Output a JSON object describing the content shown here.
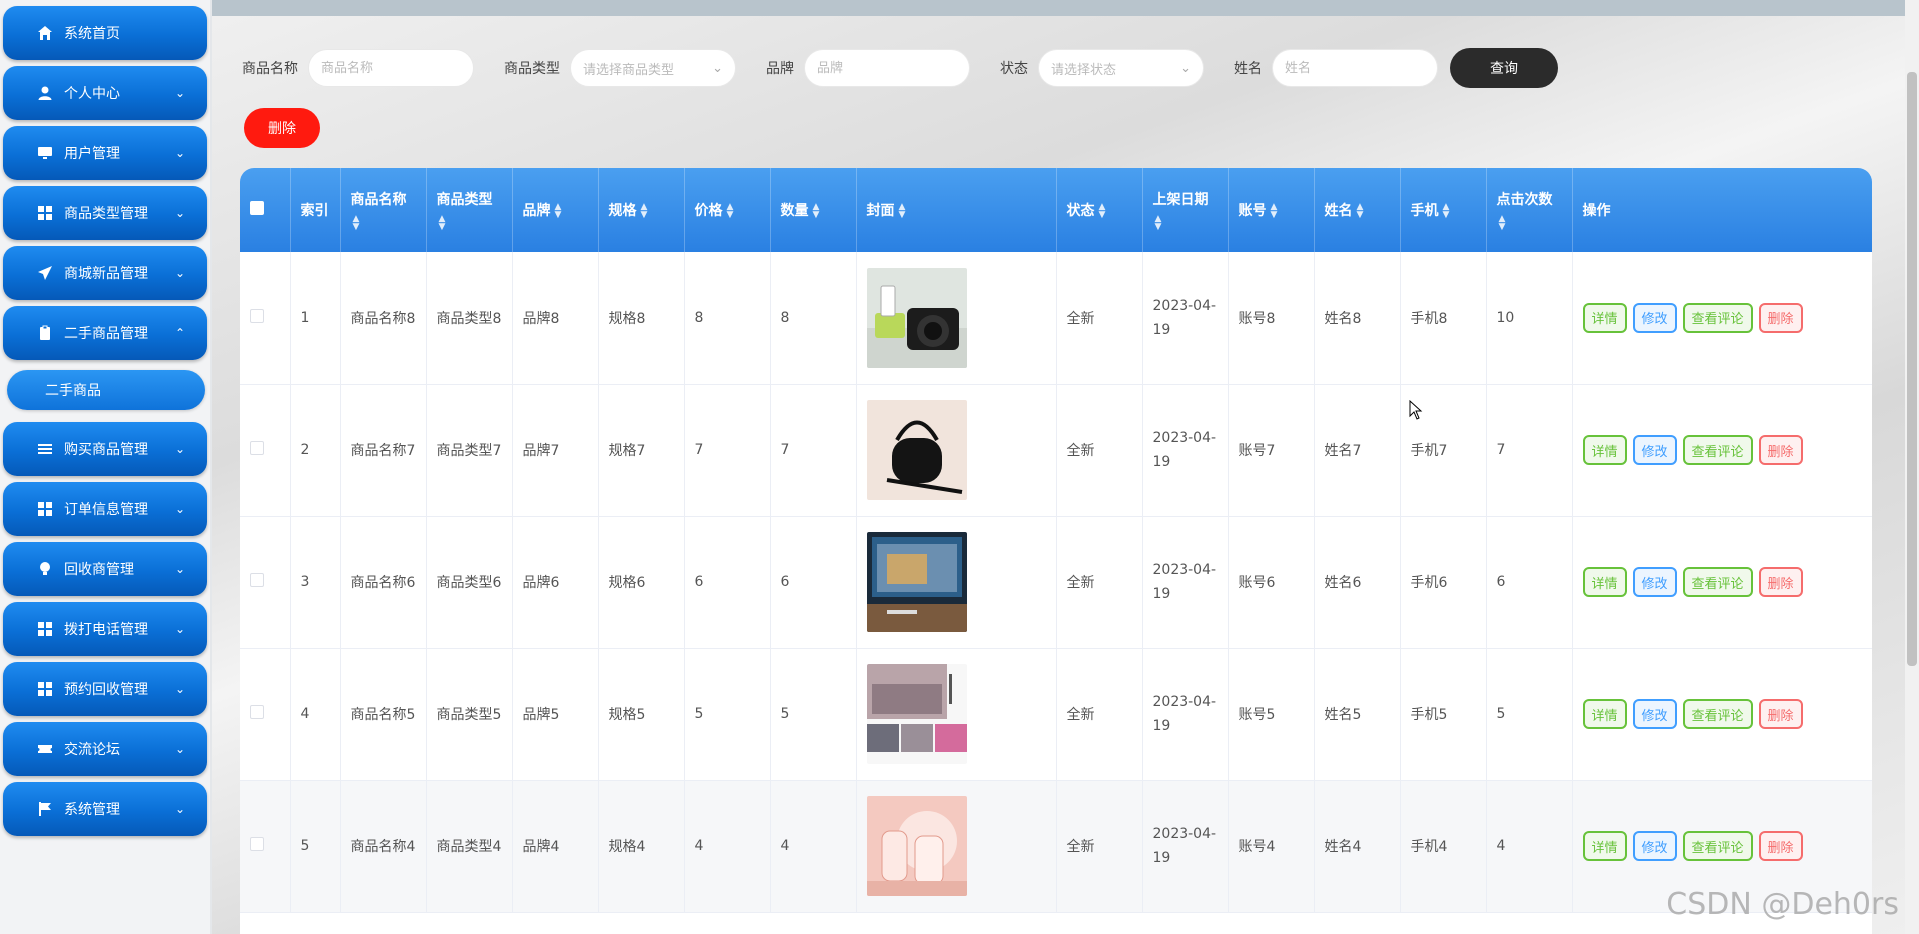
{
  "sidebar": {
    "items": [
      {
        "label": "系统首页",
        "icon": "home-icon",
        "chevron": ""
      },
      {
        "label": "个人中心",
        "icon": "user-icon",
        "chevron": "⌄"
      },
      {
        "label": "用户管理",
        "icon": "monitor-icon",
        "chevron": "⌄"
      },
      {
        "label": "商品类型管理",
        "icon": "grid-icon",
        "chevron": "⌄"
      },
      {
        "label": "商城新品管理",
        "icon": "send-icon",
        "chevron": "⌄"
      },
      {
        "label": "二手商品管理",
        "icon": "clipboard-icon",
        "chevron": "⌃"
      },
      {
        "label": "购买商品管理",
        "icon": "list-icon",
        "chevron": "⌄"
      },
      {
        "label": "订单信息管理",
        "icon": "grid-icon",
        "chevron": "⌄"
      },
      {
        "label": "回收商管理",
        "icon": "bulb-icon",
        "chevron": "⌄"
      },
      {
        "label": "拨打电话管理",
        "icon": "grid-icon",
        "chevron": "⌄"
      },
      {
        "label": "预约回收管理",
        "icon": "grid-icon",
        "chevron": "⌄"
      },
      {
        "label": "交流论坛",
        "icon": "ticket-icon",
        "chevron": "⌄"
      },
      {
        "label": "系统管理",
        "icon": "flag-icon",
        "chevron": "⌄"
      }
    ],
    "active_sub": "二手商品"
  },
  "search": {
    "name_label": "商品名称",
    "name_placeholder": "商品名称",
    "type_label": "商品类型",
    "type_placeholder": "请选择商品类型",
    "brand_label": "品牌",
    "brand_placeholder": "品牌",
    "status_label": "状态",
    "status_placeholder": "请选择状态",
    "person_label": "姓名",
    "person_placeholder": "姓名",
    "query_label": "查询"
  },
  "toolbar": {
    "delete_label": "删除"
  },
  "table": {
    "headers": [
      "索引",
      "商品名称",
      "商品类型",
      "品牌",
      "规格",
      "价格",
      "数量",
      "封面",
      "状态",
      "上架日期",
      "账号",
      "姓名",
      "手机",
      "点击次数",
      "操作"
    ],
    "rows": [
      {
        "index": "1",
        "name": "商品名称8",
        "type": "商品类型8",
        "brand": "品牌8",
        "spec": "规格8",
        "price": "8",
        "qty": "8",
        "cover": "camera-and-cup",
        "status": "全新",
        "date": "2023-04-19",
        "account": "账号8",
        "person": "姓名8",
        "phone": "手机8",
        "clicks": "10"
      },
      {
        "index": "2",
        "name": "商品名称7",
        "type": "商品类型7",
        "brand": "品牌7",
        "spec": "规格7",
        "price": "7",
        "qty": "7",
        "cover": "black-handbag",
        "status": "全新",
        "date": "2023-04-19",
        "account": "账号7",
        "person": "姓名7",
        "phone": "手机7",
        "clicks": "7"
      },
      {
        "index": "3",
        "name": "商品名称6",
        "type": "商品类型6",
        "brand": "品牌6",
        "spec": "规格6",
        "price": "6",
        "qty": "6",
        "cover": "tv-with-backlight",
        "status": "全新",
        "date": "2023-04-19",
        "account": "账号6",
        "person": "姓名6",
        "phone": "手机6",
        "clicks": "6"
      },
      {
        "index": "4",
        "name": "商品名称5",
        "type": "商品类型5",
        "brand": "品牌5",
        "spec": "规格5",
        "price": "5",
        "qty": "5",
        "cover": "bedding-set",
        "status": "全新",
        "date": "2023-04-19",
        "account": "账号5",
        "person": "姓名5",
        "phone": "手机5",
        "clicks": "5"
      },
      {
        "index": "5",
        "name": "商品名称4",
        "type": "商品类型4",
        "brand": "品牌4",
        "spec": "规格4",
        "price": "4",
        "qty": "4",
        "cover": "baby-bottles",
        "status": "全新",
        "date": "2023-04-19",
        "account": "账号4",
        "person": "姓名4",
        "phone": "手机4",
        "clicks": "4"
      }
    ],
    "actions": {
      "detail": "详情",
      "edit": "修改",
      "comments": "查看评论",
      "delete": "删除"
    }
  },
  "watermark": "CSDN @Deh0rs",
  "colors": {
    "sidebar_blue": "#0a6fd6",
    "header_blue": "#2a80e2",
    "delete_red": "#ff1a0f",
    "query_dark": "#2b2b2b"
  }
}
